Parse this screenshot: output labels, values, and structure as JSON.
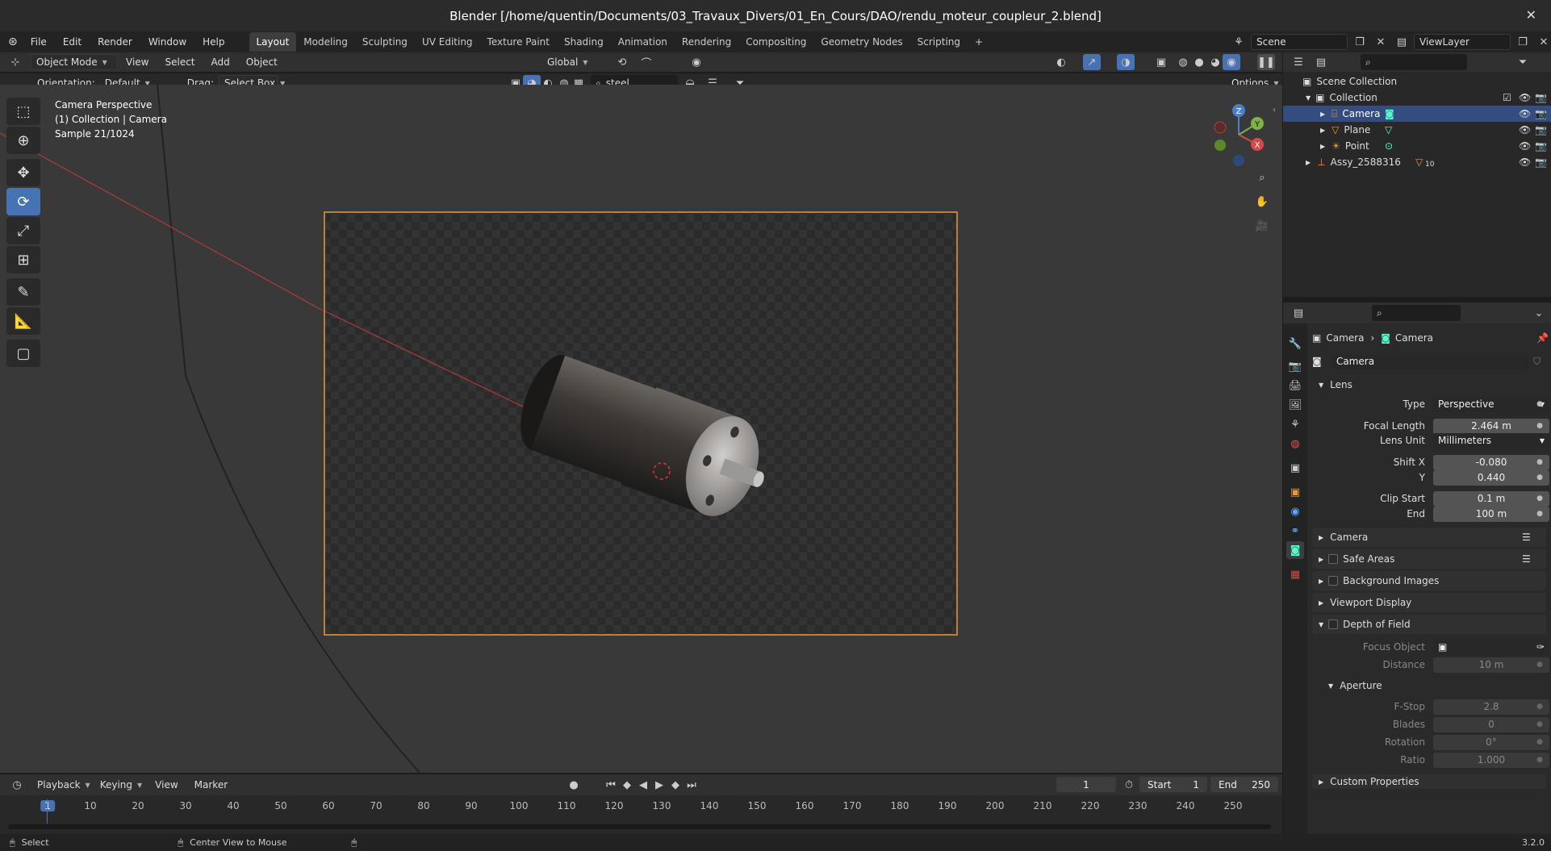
{
  "title": "Blender [/home/quentin/Documents/03_Travaux_Divers/01_En_Cours/DAO/rendu_moteur_coupleur_2.blend]",
  "menu": [
    "File",
    "Edit",
    "Render",
    "Window",
    "Help"
  ],
  "workspaces": [
    "Layout",
    "Modeling",
    "Sculpting",
    "UV Editing",
    "Texture Paint",
    "Shading",
    "Animation",
    "Rendering",
    "Compositing",
    "Geometry Nodes",
    "Scripting"
  ],
  "active_workspace": "Layout",
  "scene": "Scene",
  "view_layer": "ViewLayer",
  "viewport_header": {
    "mode": "Object Mode",
    "menus": [
      "View",
      "Select",
      "Add",
      "Object"
    ],
    "transform_orientation": "Global",
    "orientation_label": "Orientation:",
    "orientation_value": "Default",
    "drag_label": "Drag:",
    "drag_value": "Select Box",
    "search_value": "steel",
    "options": "Options"
  },
  "viewport_overlay": {
    "line1": "Camera Perspective",
    "line2": "(1) Collection | Camera",
    "line3": "Sample 21/1024"
  },
  "gizmo": {
    "z": "Z",
    "y": "Y",
    "x": "X"
  },
  "outliner": {
    "scene_collection": "Scene Collection",
    "collection": "Collection",
    "items": [
      "Camera",
      "Plane",
      "Point"
    ],
    "assembly": "Assy_2588316",
    "assembly_badge": "10",
    "selected": "Camera"
  },
  "properties": {
    "breadcrumb_obj": "Camera",
    "breadcrumb_data": "Camera",
    "datablock": "Camera",
    "lens_panel": "Lens",
    "type_label": "Type",
    "type_value": "Perspective",
    "focal_label": "Focal Length",
    "focal_value": "2.464 m",
    "lens_unit_label": "Lens Unit",
    "lens_unit_value": "Millimeters",
    "shiftx_label": "Shift X",
    "shiftx_value": "-0.080",
    "shifty_label": "Y",
    "shifty_value": "0.440",
    "clipstart_label": "Clip Start",
    "clipstart_value": "0.1 m",
    "clipend_label": "End",
    "clipend_value": "100 m",
    "panel_camera": "Camera",
    "panel_safe": "Safe Areas",
    "panel_bg": "Background Images",
    "panel_viewport": "Viewport Display",
    "panel_dof": "Depth of Field",
    "focus_label": "Focus Object",
    "distance_label": "Distance",
    "distance_value": "10 m",
    "aperture_panel": "Aperture",
    "fstop_label": "F-Stop",
    "fstop_value": "2.8",
    "blades_label": "Blades",
    "blades_value": "0",
    "rotation_label": "Rotation",
    "rotation_value": "0°",
    "ratio_label": "Ratio",
    "ratio_value": "1.000",
    "custom_panel": "Custom Properties"
  },
  "timeline": {
    "menus": [
      "Playback",
      "Keying",
      "View",
      "Marker"
    ],
    "current_frame": "1",
    "start_label": "Start",
    "start_value": "1",
    "end_label": "End",
    "end_value": "250",
    "ticks": [
      "1",
      "10",
      "20",
      "30",
      "40",
      "50",
      "60",
      "70",
      "80",
      "90",
      "100",
      "110",
      "120",
      "130",
      "140",
      "150",
      "160",
      "170",
      "180",
      "190",
      "200",
      "210",
      "220",
      "230",
      "240",
      "250"
    ]
  },
  "status": {
    "select": "Select",
    "center": "Center View to Mouse",
    "version": "3.2.0"
  },
  "colors": {
    "accent": "#4772b3",
    "camera_frame": "#e89a3c",
    "selection": "#334d80"
  }
}
